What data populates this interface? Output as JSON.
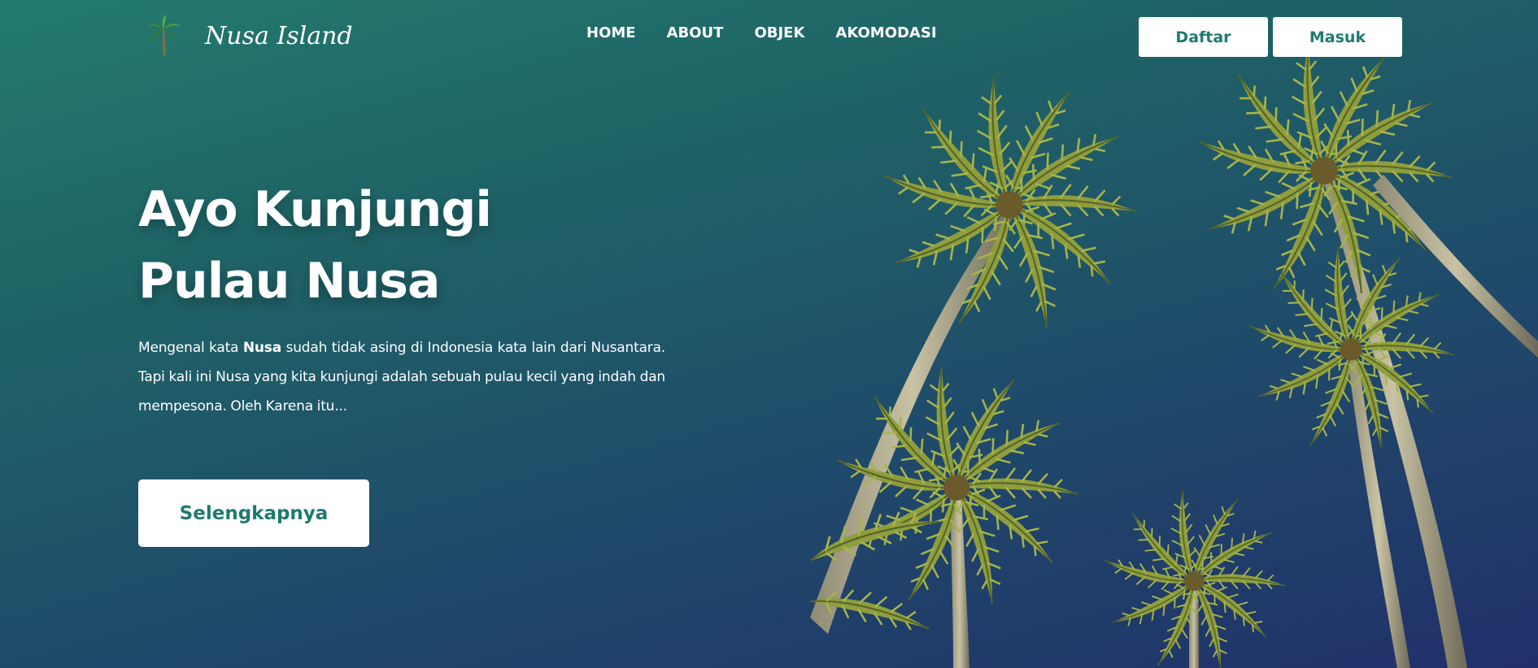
{
  "brand": {
    "name": "Nusa Island",
    "logo_icon": "palm-tree-icon"
  },
  "nav": {
    "items": [
      {
        "label": "HOME"
      },
      {
        "label": "ABOUT"
      },
      {
        "label": "OBJEK"
      },
      {
        "label": "AKOMODASI"
      }
    ]
  },
  "auth": {
    "register_label": "Daftar",
    "login_label": "Masuk"
  },
  "hero": {
    "title_line1": "Ayo Kunjungi",
    "title_line2": "Pulau Nusa",
    "desc_before": "Mengenal kata ",
    "desc_bold": "Nusa",
    "desc_after": " sudah tidak asing di Indonesia kata lain dari Nusantara. Tapi kali ini Nusa yang kita kunjungi adalah sebuah pulau kecil yang indah dan mempesona. Oleh Karena itu...",
    "cta_label": "Selengkapnya"
  },
  "colors": {
    "accent": "#1f7a6e",
    "gradient_start": "#237a6e",
    "gradient_end": "#21306a",
    "button_bg": "#ffffff"
  },
  "background_image": {
    "icon": "palm-trees-photo"
  }
}
